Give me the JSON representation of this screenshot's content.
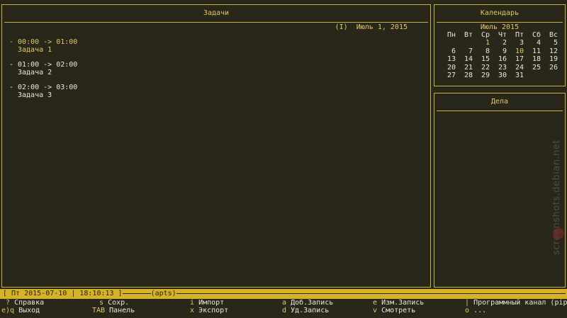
{
  "tasks": {
    "title": "Задачи",
    "date_line": "(I)  Июль 1, 2015",
    "appointments": [
      {
        "time": "- 00:00 -> 01:00",
        "desc": "Задача 1",
        "selected": false
      },
      {
        "time": "- 01:00 -> 02:00",
        "desc": "Задача 2",
        "selected": true
      },
      {
        "time": "- 02:00 -> 03:00",
        "desc": "Задача 3",
        "selected": true
      }
    ]
  },
  "calendar": {
    "title": "Календарь",
    "month": "Июль 2015",
    "weekdays": [
      "Пн",
      "Вт",
      "Ср",
      "Чт",
      "Пт",
      "Сб",
      "Вс"
    ],
    "weeks": [
      [
        "",
        "",
        "1",
        "2",
        "3",
        "4",
        "5"
      ],
      [
        "6",
        "7",
        "8",
        "9",
        "10",
        "11",
        "12"
      ],
      [
        "13",
        "14",
        "15",
        "16",
        "17",
        "18",
        "19"
      ],
      [
        "20",
        "21",
        "22",
        "23",
        "24",
        "25",
        "26"
      ],
      [
        "27",
        "28",
        "29",
        "30",
        "31",
        "",
        ""
      ]
    ],
    "highlighted_days": [
      "1",
      "10"
    ]
  },
  "todo": {
    "title": "Дела"
  },
  "status": {
    "text": "[ Пт 2015-07-10 | 18:10:13 ]",
    "tail": "(apts)"
  },
  "keybindings": [
    [
      {
        "key": "?",
        "label": "Справка"
      },
      {
        "key": "s",
        "label": "Сохр."
      },
      {
        "key": "i",
        "label": "Импорт"
      },
      {
        "key": "a",
        "label": "Доб.Запись"
      },
      {
        "key": "e",
        "label": "Изм.Запись"
      },
      {
        "key": "|",
        "label": "Программный канал (pip"
      }
    ],
    [
      {
        "key": "e)q",
        "label": "Выход"
      },
      {
        "key": "TAB",
        "label": "Панель"
      },
      {
        "key": "x",
        "label": "Экспорт"
      },
      {
        "key": "d",
        "label": "Уд.Запись"
      },
      {
        "key": "v",
        "label": "Смотреть"
      },
      {
        "key": "o",
        "label": "..."
      }
    ]
  ],
  "watermark": "screenshots.debian.net",
  "colors": {
    "background": "#29261a",
    "accent": "#e2c76a",
    "border": "#c9b043",
    "text": "#e9e6da",
    "statusbar": "#d6b22b"
  }
}
